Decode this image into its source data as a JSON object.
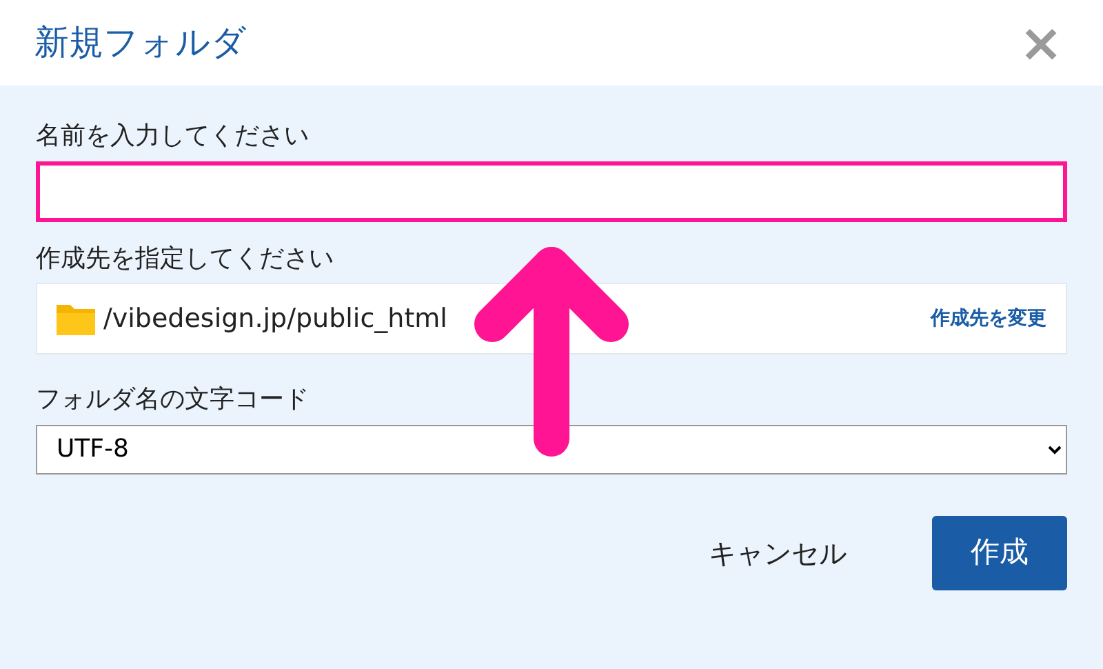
{
  "dialog": {
    "title": "新規フォルダ",
    "close": "×"
  },
  "name_field": {
    "label": "名前を入力してください",
    "highlighted": true
  },
  "destination": {
    "label": "作成先を指定してください",
    "path": "/vibedesign.jp/public_html",
    "change_link": "作成先を変更"
  },
  "encoding": {
    "label": "フォルダ名の文字コード",
    "value": "UTF-8"
  },
  "buttons": [
    {
      "kind": "text",
      "label": "キャンセル"
    },
    {
      "kind": "primary",
      "label": "作成"
    }
  ],
  "annotations": [
    {
      "kind": "arrow"
    }
  ]
}
